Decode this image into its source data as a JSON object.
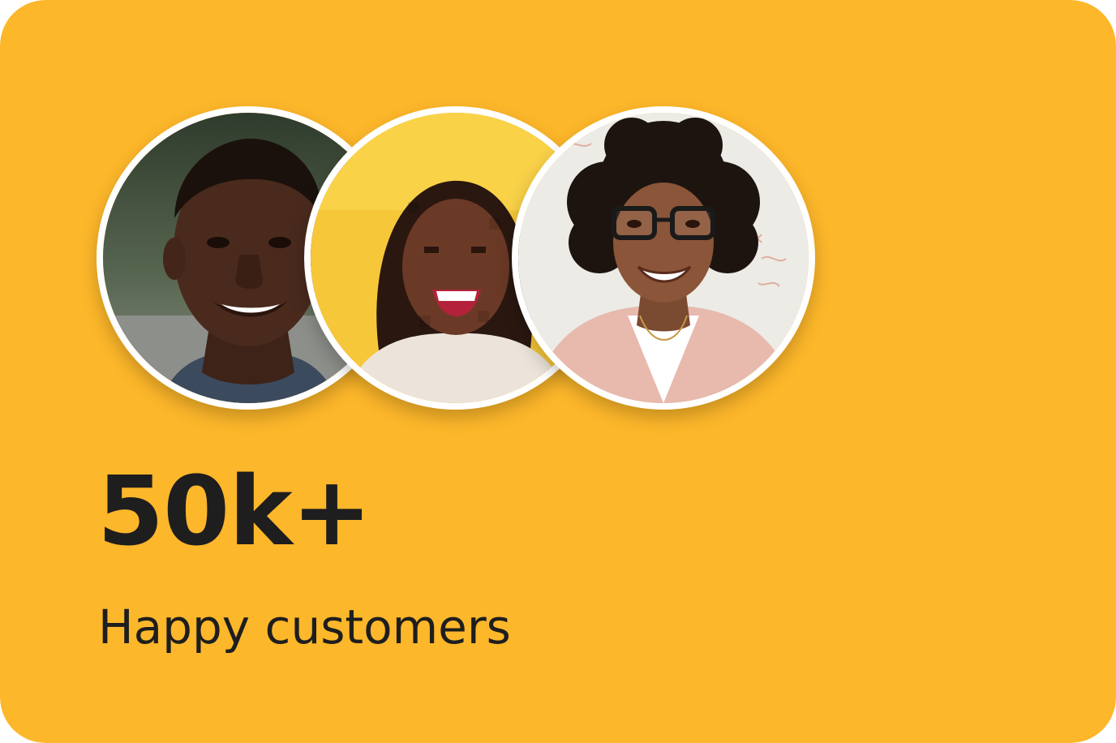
{
  "card": {
    "background_color": "#FDB72A",
    "text_color": "#1E1E1E",
    "border_color": "#FFFFFF"
  },
  "stat": {
    "value": "50k+",
    "label": "Happy customers"
  },
  "avatars": [
    {
      "semantic": "customer-photo-man-smiling"
    },
    {
      "semantic": "customer-photo-woman-laughing-yellow-background"
    },
    {
      "semantic": "customer-photo-woman-glasses-pink-blazer"
    }
  ]
}
